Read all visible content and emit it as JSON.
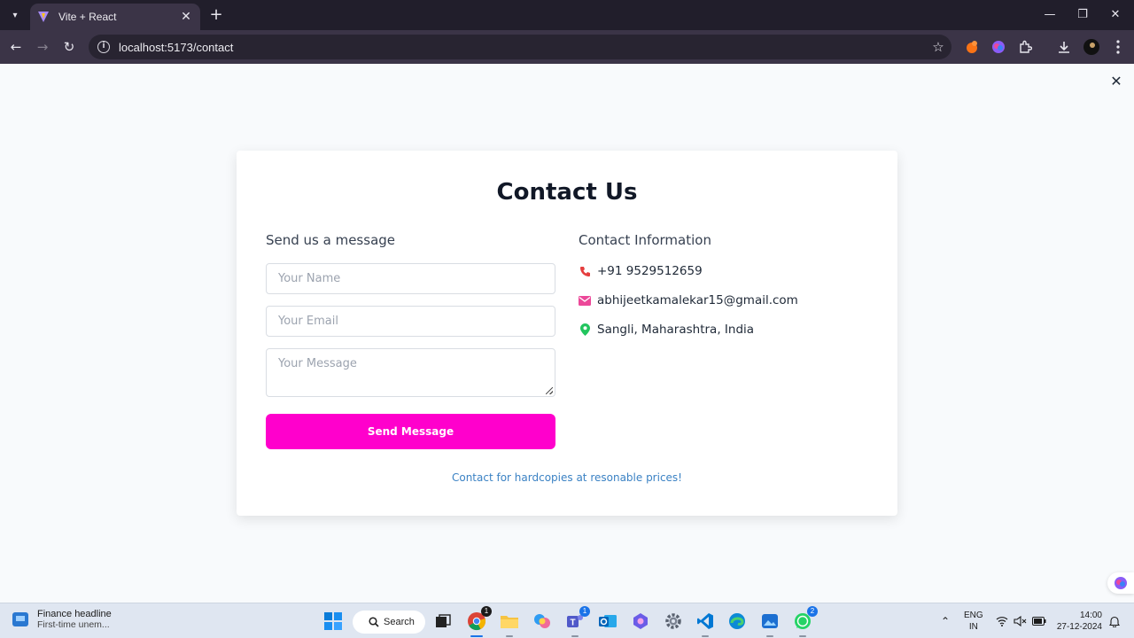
{
  "browser": {
    "tab_title": "Vite + React",
    "url": "localhost:5173/contact"
  },
  "page": {
    "title": "Contact Us",
    "form": {
      "heading": "Send us a message",
      "name_placeholder": "Your Name",
      "email_placeholder": "Your Email",
      "message_placeholder": "Your Message",
      "submit_label": "Send Message"
    },
    "info": {
      "heading": "Contact Information",
      "phone": "+91 9529512659",
      "email": "abhijeetkamalekar15@gmail.com",
      "location": "Sangli, Maharashtra, India"
    },
    "footer_note": "Contact for hardcopies at resonable prices!",
    "accent_color": "#ff00cc"
  },
  "taskbar": {
    "news_headline": "Finance headline",
    "news_subtext": "First-time unem...",
    "search_label": "Search",
    "chrome_badge": "1",
    "teams_badge": "1",
    "whatsapp_badge": "2",
    "lang_top": "ENG",
    "lang_bottom": "IN",
    "time": "14:00",
    "date": "27-12-2024"
  }
}
